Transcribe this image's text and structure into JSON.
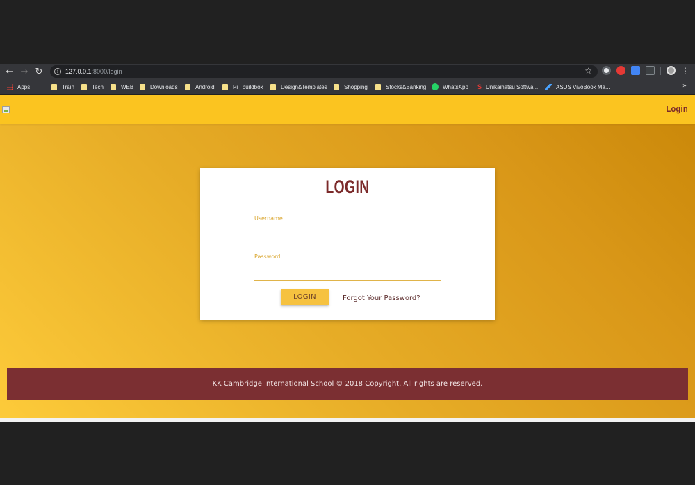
{
  "browser": {
    "url_host": "127.0.0.1",
    "url_rest": ":8000/login",
    "bookmarks": [
      {
        "label": "Apps",
        "icon": "apps-grid-icon"
      },
      {
        "label": "Train",
        "icon": "folder-icon"
      },
      {
        "label": "Tech",
        "icon": "folder-icon"
      },
      {
        "label": "WEB",
        "icon": "folder-icon"
      },
      {
        "label": "Downloads",
        "icon": "folder-icon"
      },
      {
        "label": "Android",
        "icon": "folder-icon"
      },
      {
        "label": "Pi , buildbox",
        "icon": "folder-icon"
      },
      {
        "label": "Design&Templates",
        "icon": "folder-icon"
      },
      {
        "label": "Shopping",
        "icon": "folder-icon"
      },
      {
        "label": "Stocks&Banking",
        "icon": "folder-icon"
      },
      {
        "label": "WhatsApp",
        "icon": "whatsapp-icon"
      },
      {
        "label": "Unikaihatsu Softwa...",
        "icon": "unikaihatsu-icon"
      },
      {
        "label": "ASUS VivoBook Ma...",
        "icon": "asus-icon"
      }
    ],
    "more_label": "»"
  },
  "navbar": {
    "login_link": "Login"
  },
  "login_card": {
    "title": "LOGIN",
    "username_label": "Username",
    "username_value": "",
    "password_label": "Password",
    "password_value": "",
    "submit_label": "LOGIN",
    "forgot_label": "Forgot Your Password?"
  },
  "footer": {
    "text": "KK Cambridge International School © 2018 Copyright. All rights are reserved."
  },
  "colors": {
    "navbar_bg": "#fbc420",
    "accent_maroon": "#7b2a2a",
    "button_bg": "#f6c240",
    "footer_bg": "#7b2f32"
  }
}
